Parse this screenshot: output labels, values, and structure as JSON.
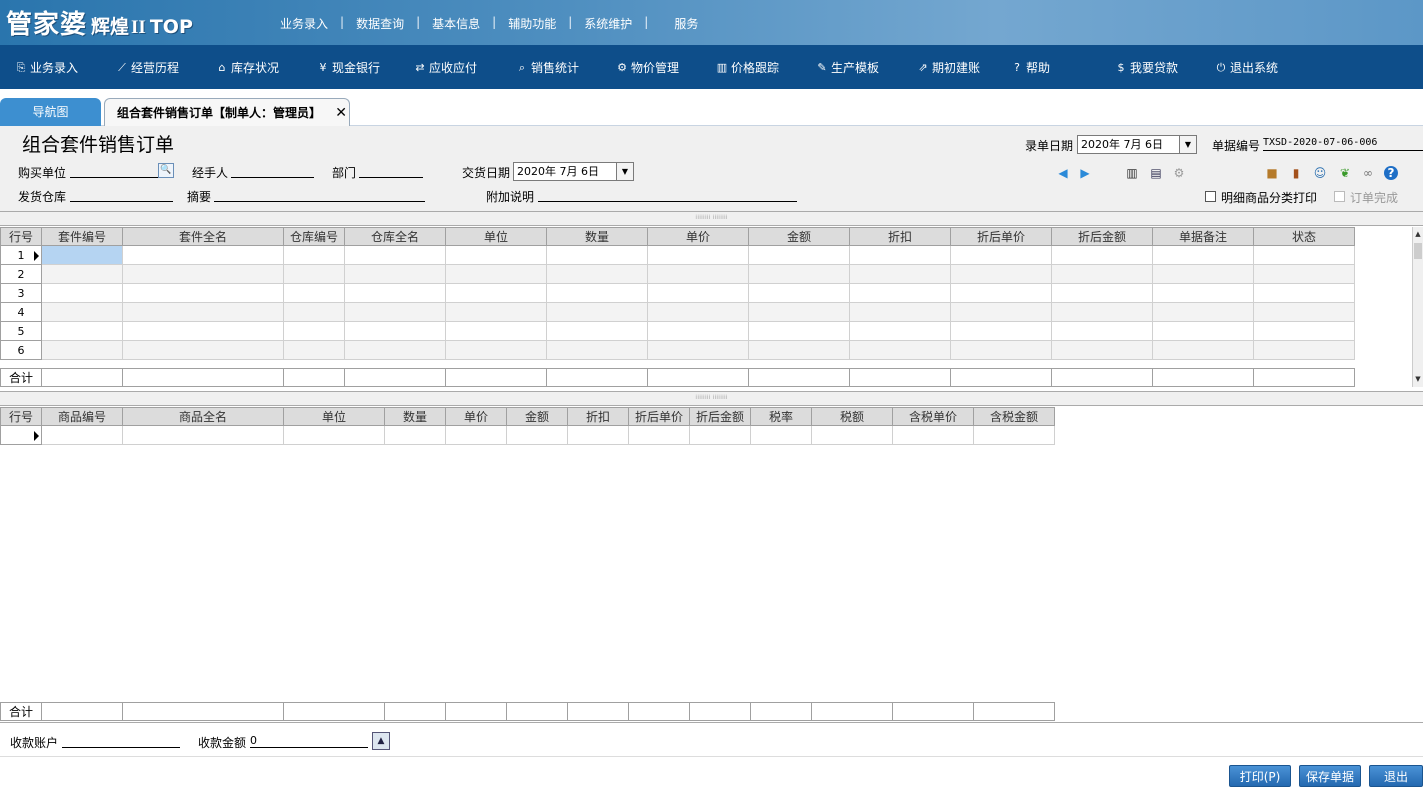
{
  "logo": {
    "part1": "管家婆",
    "part2": "辉煌",
    "part3": "II",
    "part4": "TOP"
  },
  "top_menu": [
    "业务录入",
    "数据查询",
    "基本信息",
    "辅助功能",
    "系统维护",
    "服务"
  ],
  "toolbar": [
    {
      "label": "业务录入",
      "icon": "document-icon",
      "glyph": "⎘"
    },
    {
      "label": "经营历程",
      "icon": "chart-line-icon",
      "glyph": "⟋"
    },
    {
      "label": "库存状况",
      "icon": "home-icon",
      "glyph": "⌂"
    },
    {
      "label": "现金银行",
      "icon": "yen-icon",
      "glyph": "¥"
    },
    {
      "label": "应收应付",
      "icon": "exchange-icon",
      "glyph": "⇄"
    },
    {
      "label": "销售统计",
      "icon": "search-icon",
      "glyph": "⌕"
    },
    {
      "label": "物价管理",
      "icon": "gear-icon",
      "glyph": "⚙"
    },
    {
      "label": "价格跟踪",
      "icon": "bar-chart-icon",
      "glyph": "▥"
    },
    {
      "label": "生产模板",
      "icon": "wrench-icon",
      "glyph": "✎"
    },
    {
      "label": "期初建账",
      "icon": "external-link-icon",
      "glyph": "⇗"
    },
    {
      "label": "帮助",
      "icon": "question-icon",
      "glyph": "?"
    },
    {
      "label": "我要贷款",
      "icon": "money-bag-icon",
      "glyph": "$"
    },
    {
      "label": "退出系统",
      "icon": "power-icon",
      "glyph": "⏻"
    }
  ],
  "tabs": {
    "nav": "导航图",
    "active": "组合套件销售订单【制单人：管理员】",
    "close": "✕"
  },
  "form": {
    "title": "组合套件销售订单",
    "entry_date_label": "录单日期",
    "entry_date": "2020年  7月  6日",
    "bill_no_label": "单据编号",
    "bill_no": "TXSD-2020-07-06-006",
    "buyer_label": "购买单位",
    "handler_label": "经手人",
    "dept_label": "部门",
    "delivery_date_label": "交货日期",
    "delivery_date": "2020年  7月  6日",
    "warehouse_label": "发货仓库",
    "summary_label": "摘要",
    "note_label": "附加说明",
    "detail_print_label": "明细商品分类打印",
    "order_done_label": "订单完成"
  },
  "grid1": {
    "columns": [
      "行号",
      "套件编号",
      "套件全名",
      "仓库编号",
      "仓库全名",
      "单位",
      "数量",
      "单价",
      "金额",
      "折扣",
      "折后单价",
      "折后金额",
      "单据备注",
      "状态"
    ],
    "rows": [
      "1",
      "2",
      "3",
      "4",
      "5",
      "6"
    ],
    "sum_label": "合计"
  },
  "grid2": {
    "columns": [
      "行号",
      "商品编号",
      "商品全名",
      "单位",
      "数量",
      "单价",
      "金额",
      "折扣",
      "折后单价",
      "折后金额",
      "税率",
      "税额",
      "含税单价",
      "含税金额"
    ],
    "sum_label": "合计"
  },
  "footer": {
    "account_label": "收款账户",
    "amount_label": "收款金额",
    "amount_value": "0",
    "print_btn": "打印(P)",
    "save_btn": "保存单据",
    "exit_btn": "退出"
  }
}
